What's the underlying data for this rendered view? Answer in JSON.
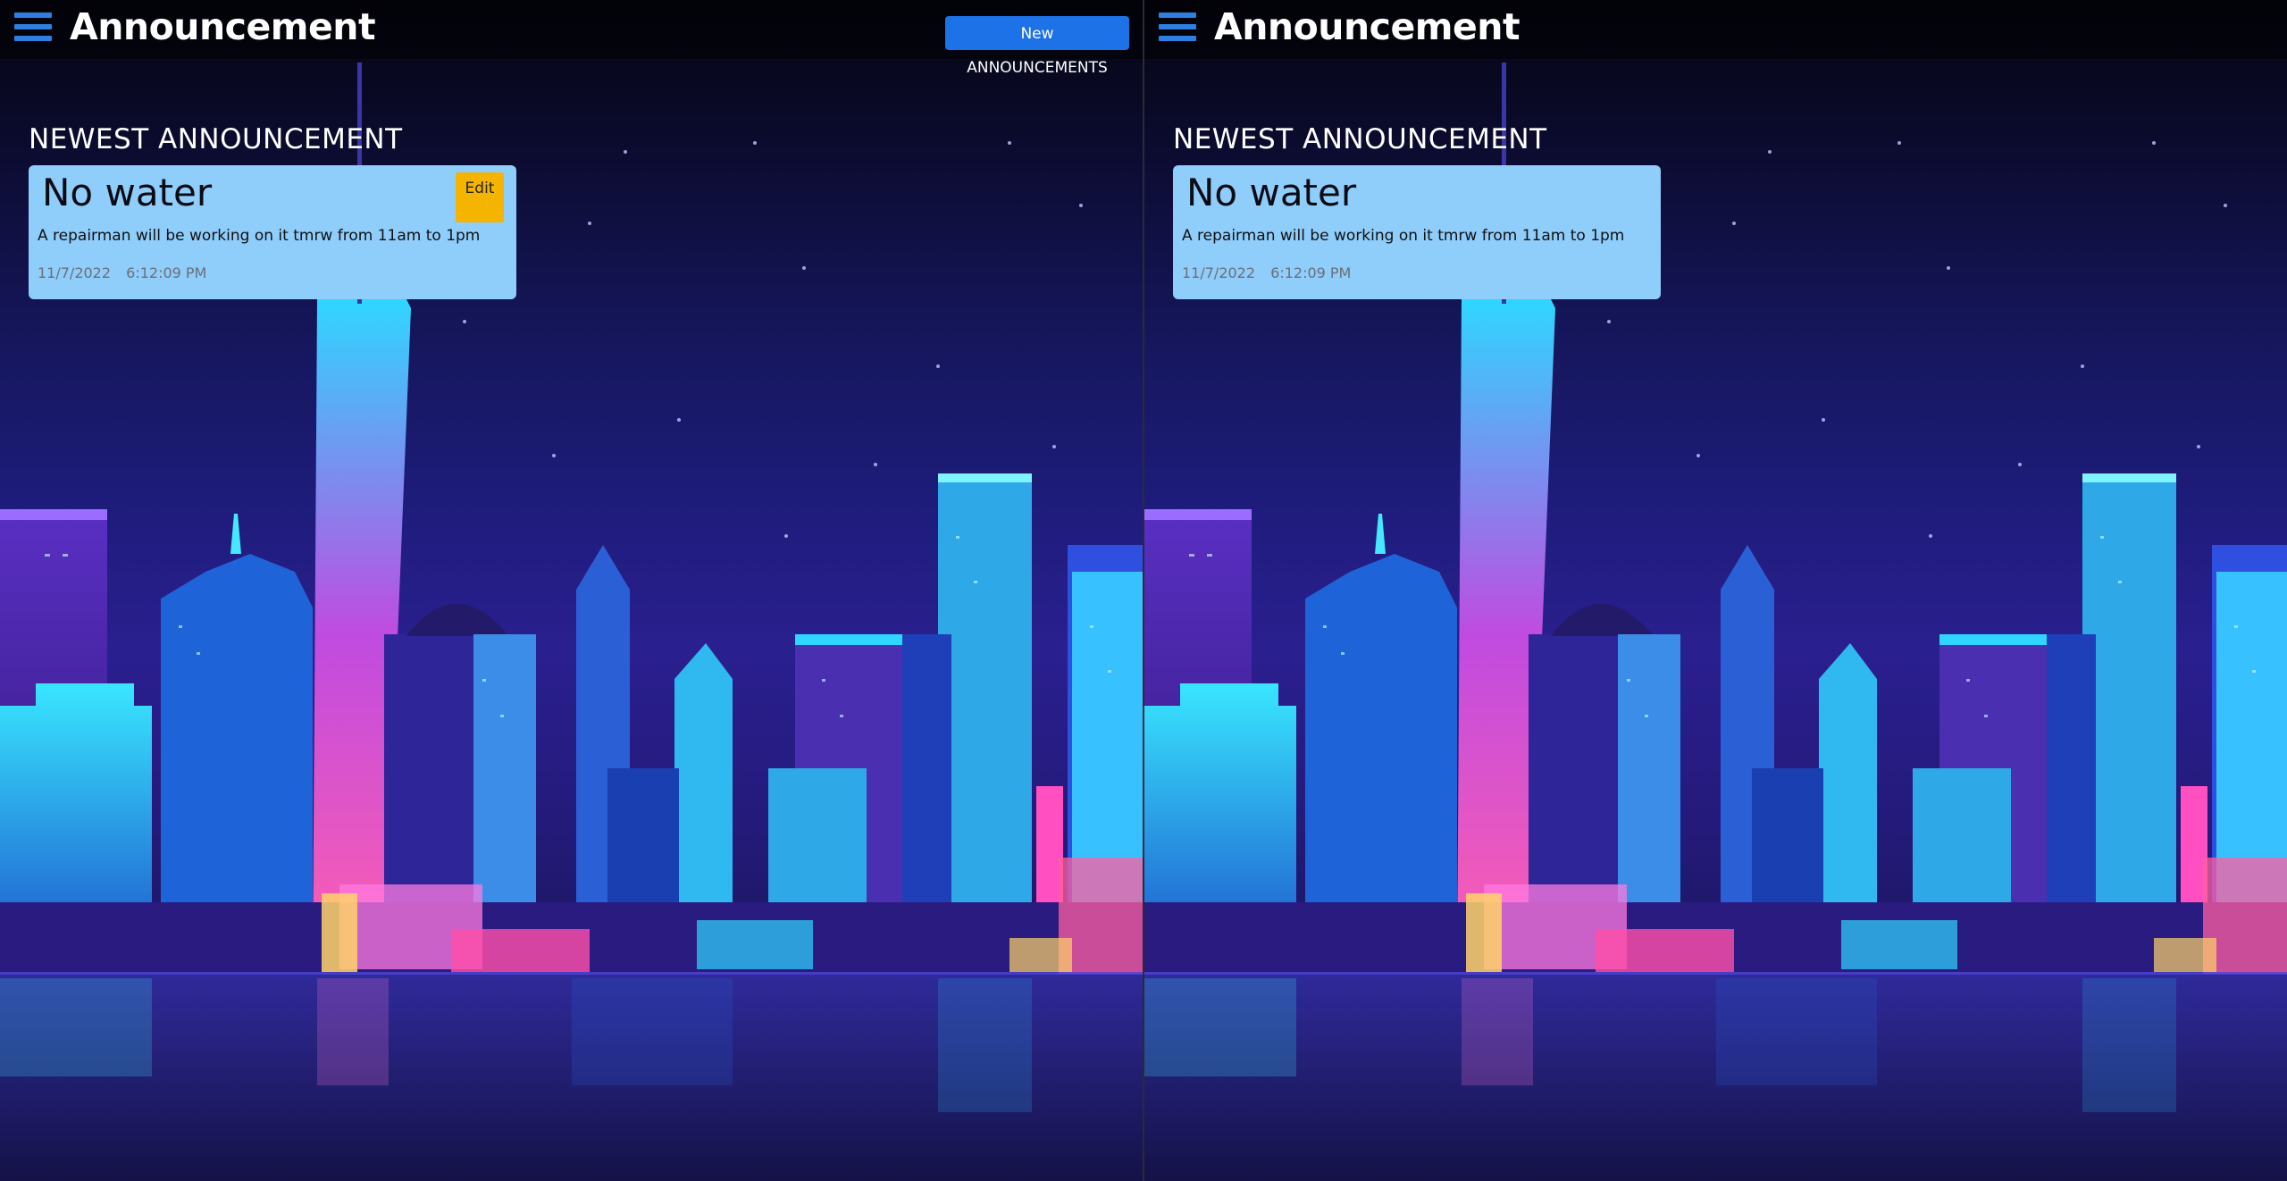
{
  "panes": [
    {
      "header": {
        "title": "Announcement",
        "new_button": "New ANNOUNCEMENTS"
      },
      "section_heading": "NEWEST ANNOUNCEMENT",
      "card": {
        "title": "No water",
        "edit_label": "Edit",
        "body": "A repairman will be working on it tmrw from 11am to 1pm",
        "date": "11/7/2022",
        "time": "6:12:09 PM"
      }
    },
    {
      "header": {
        "title": "Announcement"
      },
      "section_heading": "NEWEST ANNOUNCEMENT",
      "card": {
        "title": "No water",
        "body": "A repairman will be working on it tmrw from 11am to 1pm",
        "date": "11/7/2022",
        "time": "6:12:09 PM"
      }
    }
  ],
  "icons": {
    "menu": "hamburger-menu-icon"
  },
  "colors": {
    "accent": "#1d72e8",
    "menu_icon": "#2f7fe0",
    "card_bg": "#8fcdfb",
    "edit_button": "#f4b400"
  }
}
